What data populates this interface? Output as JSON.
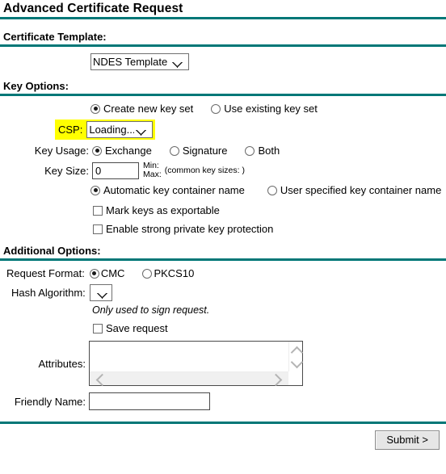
{
  "page": {
    "title": "Advanced Certificate Request",
    "accent_color": "#007777",
    "highlight_color": "#ffff00"
  },
  "certificate_template": {
    "section_label": "Certificate Template:",
    "select_value": "NDES Template",
    "options": [
      "NDES Template"
    ]
  },
  "key_options": {
    "section_label": "Key Options:",
    "key_set": {
      "create_new_label": "Create new key set",
      "use_existing_label": "Use existing key set",
      "selected": "create_new"
    },
    "csp": {
      "label": "CSP:",
      "select_value": "Loading...",
      "options": [
        "Loading..."
      ],
      "highlighted": true
    },
    "key_usage": {
      "label": "Key Usage:",
      "options": [
        "Exchange",
        "Signature",
        "Both"
      ],
      "selected": "Exchange"
    },
    "key_size": {
      "label": "Key Size:",
      "value": "0",
      "min_label": "Min:",
      "max_label": "Max:",
      "min_value": "",
      "max_value": "",
      "common_sizes_text": "(common key sizes: )"
    },
    "container_name": {
      "automatic_label": "Automatic key container name",
      "user_specified_label": "User specified key container name",
      "selected": "automatic"
    },
    "checkboxes": [
      {
        "label": "Mark keys as exportable",
        "checked": false
      },
      {
        "label": "Enable strong private key protection",
        "checked": false
      }
    ]
  },
  "additional_options": {
    "section_label": "Additional Options:",
    "request_format": {
      "label": "Request Format:",
      "options": [
        "CMC",
        "PKCS10"
      ],
      "selected": "CMC"
    },
    "hash_algorithm": {
      "label": "Hash Algorithm:",
      "select_value": "",
      "options": [
        ""
      ],
      "note": "Only used to sign request."
    },
    "save_request": {
      "label": "Save request",
      "checked": false
    },
    "attributes": {
      "label": "Attributes:",
      "value": ""
    },
    "friendly_name": {
      "label": "Friendly Name:",
      "value": ""
    }
  },
  "footer": {
    "submit_label": "Submit >"
  }
}
